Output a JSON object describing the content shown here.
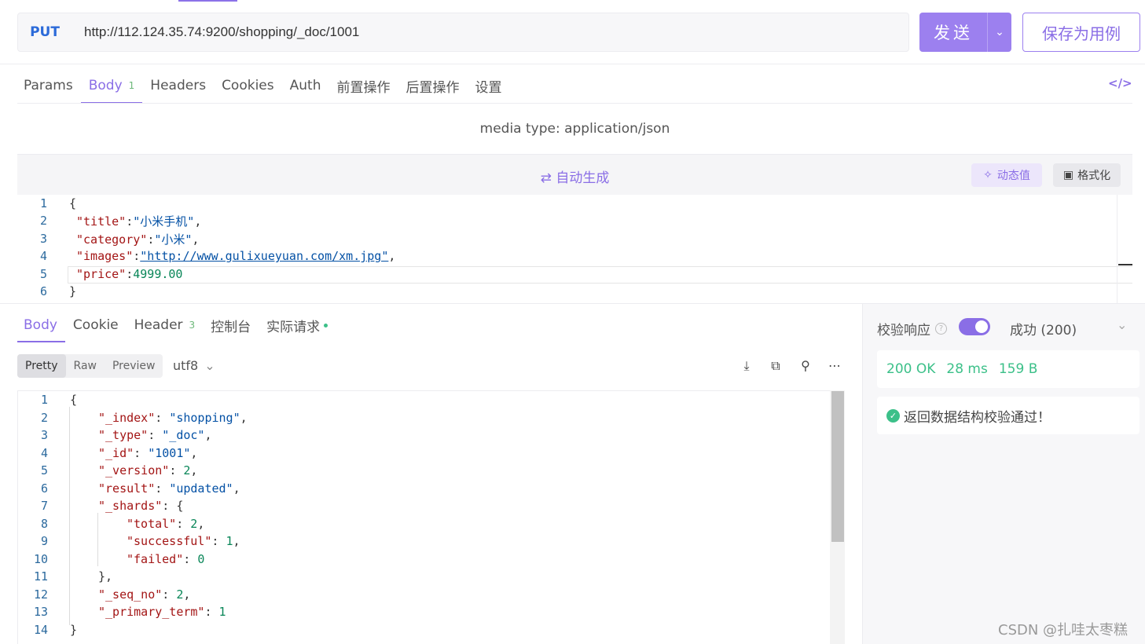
{
  "request": {
    "method": "PUT",
    "url": "http://112.124.35.74:9200/shopping/_doc/1001",
    "send_label": "发送",
    "save_label": "保存为用例"
  },
  "request_tabs": [
    {
      "label": "Params"
    },
    {
      "label": "Body",
      "badge": "1"
    },
    {
      "label": "Headers"
    },
    {
      "label": "Cookies"
    },
    {
      "label": "Auth"
    },
    {
      "label": "前置操作"
    },
    {
      "label": "后置操作"
    },
    {
      "label": "设置"
    }
  ],
  "body": {
    "media_type": "media type: application/json",
    "auto_generate": "自动生成",
    "dynamic_value": "动态值",
    "format": "格式化",
    "lines": [
      {
        "n": "1",
        "key": "",
        "value": "{"
      },
      {
        "n": "2",
        "key": "\"title\"",
        "value": "\"小米手机\""
      },
      {
        "n": "3",
        "key": "\"category\"",
        "value": "\"小米\""
      },
      {
        "n": "4",
        "key": "\"images\"",
        "value": "\"http://www.gulixueyuan.com/xm.jpg\""
      },
      {
        "n": "5",
        "key": "\"price\"",
        "value": "4999.00"
      },
      {
        "n": "6",
        "key": "",
        "value": "}"
      }
    ]
  },
  "response_tabs": [
    {
      "label": "Body"
    },
    {
      "label": "Cookie"
    },
    {
      "label": "Header",
      "badge": "3"
    },
    {
      "label": "控制台"
    },
    {
      "label": "实际请求"
    }
  ],
  "view_modes": [
    "Pretty",
    "Raw",
    "Preview"
  ],
  "encoding": "utf8",
  "response_lines": [
    {
      "n": "1",
      "text": "{"
    },
    {
      "n": "2",
      "key": "\"_index\"",
      "value": "\"shopping\""
    },
    {
      "n": "3",
      "key": "\"_type\"",
      "value": "\"_doc\""
    },
    {
      "n": "4",
      "key": "\"_id\"",
      "value": "\"1001\""
    },
    {
      "n": "5",
      "key": "\"_version\"",
      "value": "2"
    },
    {
      "n": "6",
      "key": "\"result\"",
      "value": "\"updated\""
    },
    {
      "n": "7",
      "key": "\"_shards\"",
      "value": "{"
    },
    {
      "n": "8",
      "key": "\"total\"",
      "value": "2"
    },
    {
      "n": "9",
      "key": "\"successful\"",
      "value": "1"
    },
    {
      "n": "10",
      "key": "\"failed\"",
      "value": "0"
    },
    {
      "n": "11",
      "text": "},"
    },
    {
      "n": "12",
      "key": "\"_seq_no\"",
      "value": "2"
    },
    {
      "n": "13",
      "key": "\"_primary_term\"",
      "value": "1"
    },
    {
      "n": "14",
      "text": "}"
    }
  ],
  "validation": {
    "label": "校验响应",
    "status": "成功 (200)",
    "status_code": "200 OK",
    "time": "28 ms",
    "size": "159 B",
    "message": "返回数据结构校验通过！"
  },
  "watermark": "CSDN @扎哇太枣糕",
  "colors": {
    "accent": "#8a6ee6",
    "success": "#3cc089",
    "method": "#2b6ad9"
  }
}
